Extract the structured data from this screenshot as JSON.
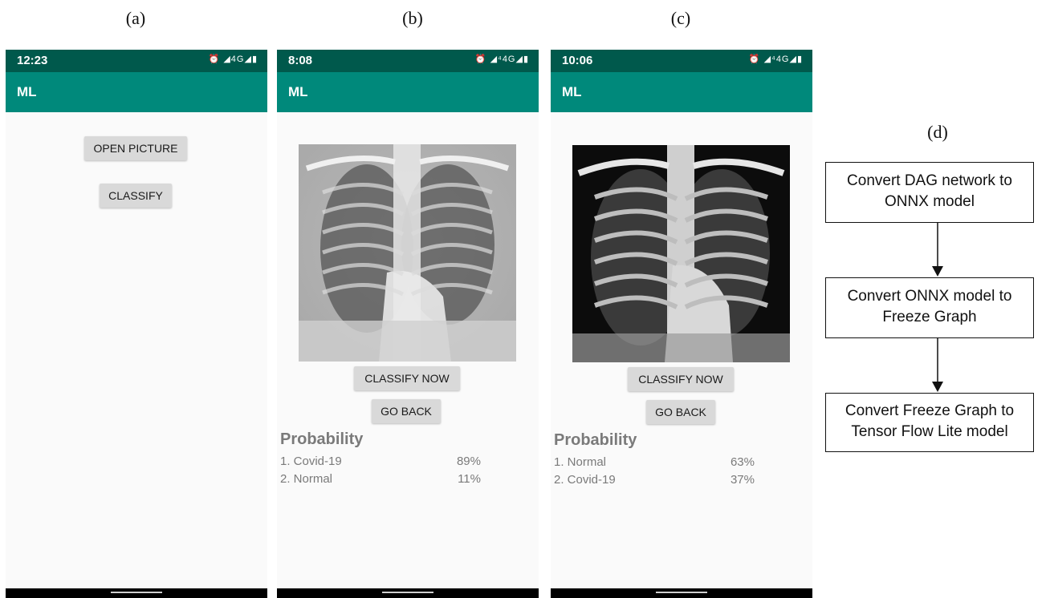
{
  "panel_labels": {
    "a": "(a)",
    "b": "(b)",
    "c": "(c)",
    "d": "(d)"
  },
  "colors": {
    "status_bar": "#00594c",
    "app_bar": "#00897b",
    "button": "#d9d9d9",
    "background": "#fafafa",
    "probability_text": "#7a7a7a"
  },
  "phones": [
    {
      "time": "12:23",
      "status_icons": "⏰ ◢4G◢▮",
      "app_title": "ML",
      "buttons": {
        "open_picture": "OPEN PICTURE",
        "classify": "CLASSIFY"
      }
    },
    {
      "time": "8:08",
      "status_icons": "⏰ ◢⁴4G◢▮",
      "app_title": "ML",
      "buttons": {
        "classify_now": "CLASSIFY NOW",
        "go_back": "GO BACK"
      },
      "image_icon": "chest-xray-image",
      "probability": {
        "title": "Probability",
        "rows": [
          {
            "label": "1. Covid-19",
            "value": "89%"
          },
          {
            "label": "2. Normal",
            "value": "11%"
          }
        ]
      }
    },
    {
      "time": "10:06",
      "status_icons": "⏰ ◢⁴4G◢▮",
      "app_title": "ML",
      "buttons": {
        "classify_now": "CLASSIFY NOW",
        "go_back": "GO BACK"
      },
      "image_icon": "chest-xray-image",
      "probability": {
        "title": "Probability",
        "rows": [
          {
            "label": "1. Normal",
            "value": "63%"
          },
          {
            "label": "2. Covid-19",
            "value": "37%"
          }
        ]
      }
    }
  ],
  "flowchart": {
    "steps": [
      {
        "line1": "Convert DAG network to",
        "line2": "ONNX model"
      },
      {
        "line1": "Convert ONNX model to",
        "line2": "Freeze Graph"
      },
      {
        "line1": "Convert Freeze Graph to",
        "line2": "Tensor Flow Lite model"
      }
    ]
  }
}
